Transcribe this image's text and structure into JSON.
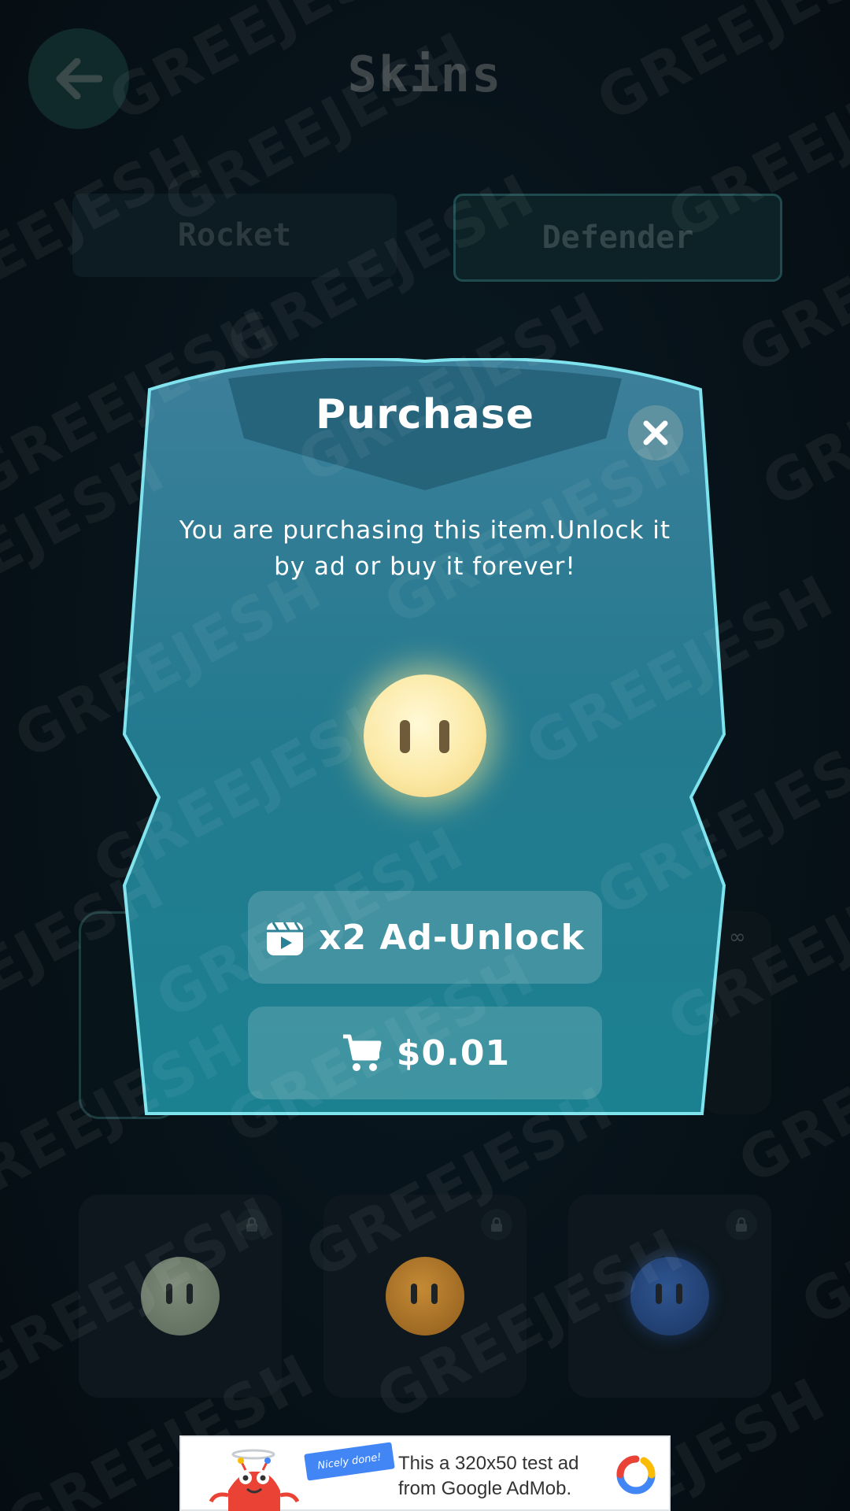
{
  "header": {
    "title": "Skins"
  },
  "tabs": [
    {
      "label": "Rocket"
    },
    {
      "label": "Defender"
    }
  ],
  "grid": {
    "infinity_symbol": "∞",
    "cards": [
      {
        "face_color": "#6f7d6c"
      },
      {
        "face_color": "#b57a2a"
      },
      {
        "face_color": "#25477c"
      }
    ]
  },
  "modal": {
    "title": "Purchase",
    "message": "You are purchasing this item.Unlock it by ad or buy it forever!",
    "ad_button_label": "x2 Ad-Unlock",
    "buy_button_label": "$0.01"
  },
  "watermark": {
    "text": "GREEJESH"
  },
  "ad_banner": {
    "text": "This a 320x50 test ad from Google AdMob.",
    "flag_text": "Nicely done!"
  },
  "colors": {
    "modal_top": "#3a7f99",
    "modal_bottom": "#1b8190",
    "modal_border": "#7fe3ee",
    "face": "#fbe9a6"
  }
}
